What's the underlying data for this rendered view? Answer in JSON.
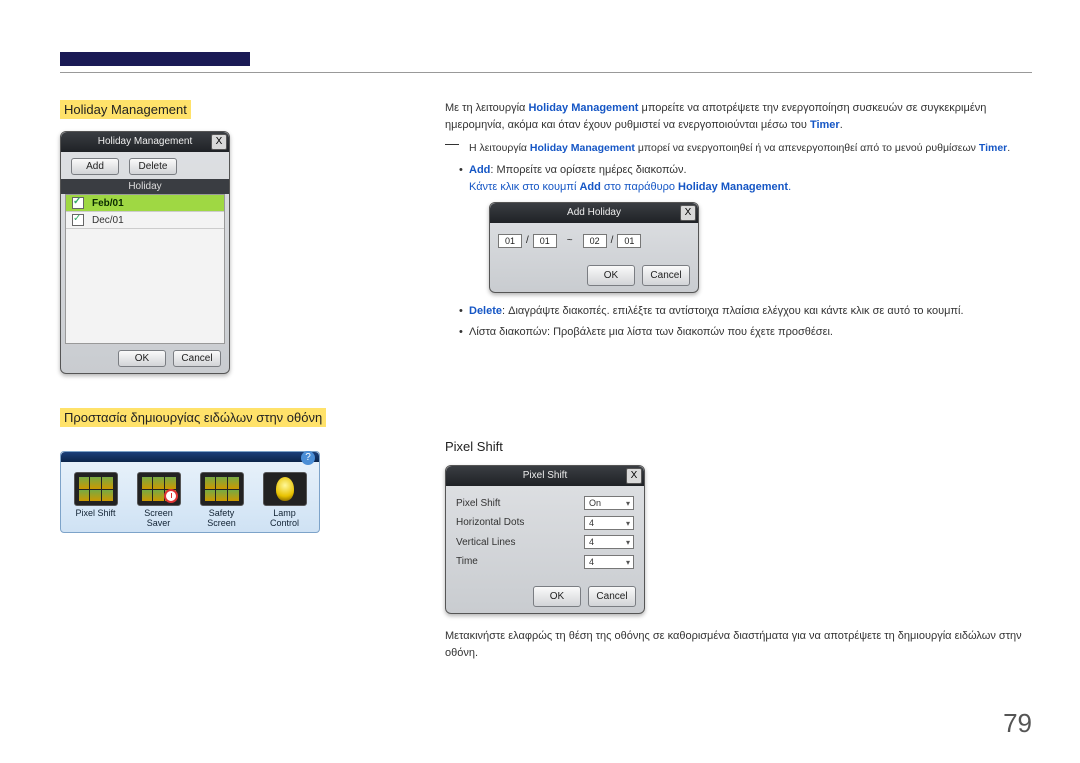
{
  "page_number": "79",
  "section1": {
    "heading": "Holiday Management",
    "panel": {
      "title": "Holiday Management",
      "close": "X",
      "add_btn": "Add",
      "delete_btn": "Delete",
      "col_head": "Holiday",
      "rows": [
        "Feb/01",
        "Dec/01"
      ],
      "ok": "OK",
      "cancel": "Cancel"
    },
    "intro_a": "Με τη λειτουργία ",
    "intro_b": " μπορείτε να αποτρέψετε την ενεργοποίηση συσκευών σε συγκεκριμένη ημερομηνία, ακόμα και όταν έχουν ρυθμιστεί να ενεργοποιούνται μέσω του ",
    "hm_term": "Holiday Management",
    "timer_term": "Timer",
    "note_a": "Η λειτουργία ",
    "note_b": " μπορεί να ενεργοποιηθεί ή να απενεργοποιηθεί από το μενού ρυθμίσεων ",
    "bul_add_term": "Add",
    "bul_add_text": ": Μπορείτε να ορίσετε ημέρες διακοπών.",
    "bul_add_click_a": "Κάντε κλικ στο κουμπί ",
    "bul_add_click_b": " στο παράθυρο ",
    "bul_add_click_c": ".",
    "add_panel": {
      "title": "Add Holiday",
      "close": "X",
      "m1": "01",
      "d1": "01",
      "sep": "/",
      "tilde": "~",
      "m2": "02",
      "d2": "01",
      "ok": "OK",
      "cancel": "Cancel"
    },
    "bul_del_term": "Delete",
    "bul_del_text": ": Διαγράψτε διακοπές. επιλέξτε τα αντίστοιχα πλαίσια ελέγχου και κάντε κλικ σε αυτό το κουμπί.",
    "bul_list_text": "Λίστα διακοπών: Προβάλετε μια λίστα των διακοπών που έχετε προσθέσει."
  },
  "section2": {
    "heading": "Προστασία δημιουργίας ειδώλων στην οθόνη",
    "icons": [
      {
        "name": "pixel-shift",
        "label": "Pixel Shift"
      },
      {
        "name": "screen-saver",
        "label": "Screen Saver"
      },
      {
        "name": "safety-screen",
        "label": "Safety Screen"
      },
      {
        "name": "lamp-control",
        "label": "Lamp Control"
      }
    ],
    "right": {
      "heading": "Pixel Shift",
      "panel": {
        "title": "Pixel Shift",
        "close": "X",
        "rows": [
          {
            "label": "Pixel Shift",
            "value": "On"
          },
          {
            "label": "Horizontal Dots",
            "value": "4"
          },
          {
            "label": "Vertical Lines",
            "value": "4"
          },
          {
            "label": "Time",
            "value": "4"
          }
        ],
        "ok": "OK",
        "cancel": "Cancel"
      },
      "desc": "Μετακινήστε ελαφρώς τη θέση της οθόνης σε καθορισμένα διαστήματα για να αποτρέψετε τη δημιουργία ειδώλων στην οθόνη."
    }
  }
}
